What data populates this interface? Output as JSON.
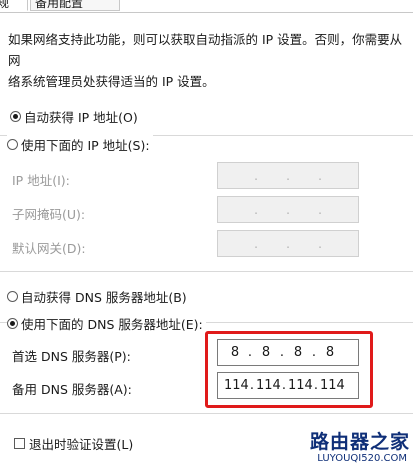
{
  "tabs": [
    {
      "label": "规"
    },
    {
      "label": "备用配置"
    }
  ],
  "description": {
    "line1": "如果网络支持此功能，则可以获取自动指派的 IP 设置。否则，你需要从网",
    "line2": "络系统管理员处获得适当的 IP 设置。"
  },
  "ip_section": {
    "auto_label": "自动获得 IP 地址(O)",
    "auto_checked": true,
    "manual_label": "使用下面的 IP 地址(S):",
    "manual_checked": false,
    "fields": [
      {
        "label": "IP 地址(I):"
      },
      {
        "label": "子网掩码(U):"
      },
      {
        "label": "默认网关(D):"
      }
    ]
  },
  "dns_section": {
    "auto_label": "自动获得 DNS 服务器地址(B)",
    "auto_checked": false,
    "manual_label": "使用下面的 DNS 服务器地址(E):",
    "manual_checked": true,
    "preferred": {
      "label": "首选 DNS 服务器(P):",
      "octets": [
        "8",
        "8",
        "8",
        "8"
      ]
    },
    "alternate": {
      "label": "备用 DNS 服务器(A):",
      "octets": [
        "114",
        "114",
        "114",
        "114"
      ]
    }
  },
  "validate_label": "退出时验证设置(L)",
  "watermark": {
    "title": "路由器之家",
    "url": "LUYOUQI520.COM"
  },
  "colors": {
    "highlight": "#e01a1a",
    "watermark": "#0f2f78"
  }
}
